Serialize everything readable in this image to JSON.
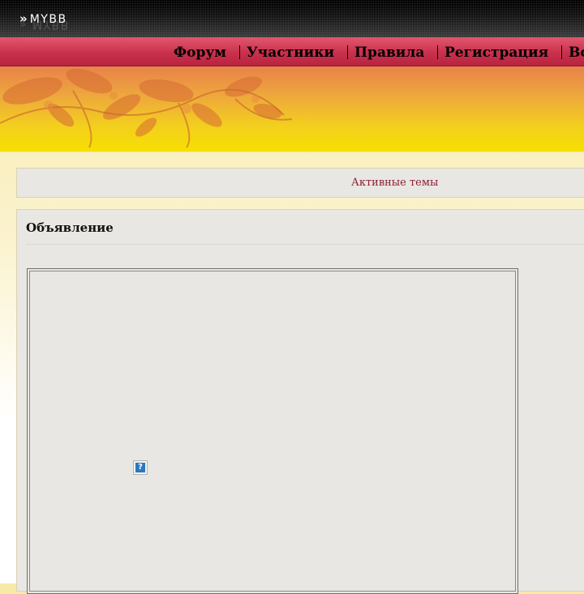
{
  "header": {
    "logo_text": "MYBB",
    "logo_chevrons": "»"
  },
  "nav": {
    "items": [
      {
        "label": "Форум"
      },
      {
        "label": "Участники"
      },
      {
        "label": "Правила"
      },
      {
        "label": "Регистрация"
      },
      {
        "label": "Во"
      }
    ]
  },
  "active_topics": {
    "label": "Активные темы"
  },
  "announcement": {
    "title": "Объявление",
    "embed_icon": "missing-plugin-icon",
    "embed_icon_glyph": "?"
  },
  "colors": {
    "nav_bg": "#c9304c",
    "banner_top": "#e8824a",
    "banner_bottom": "#f6e000",
    "panel_bg": "#e9e7e3",
    "link_color": "#8a2034"
  }
}
